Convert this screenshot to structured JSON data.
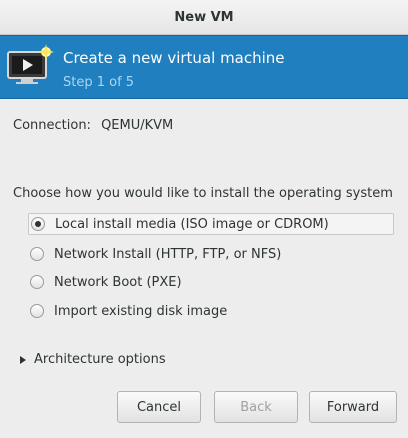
{
  "window": {
    "title": "New VM"
  },
  "banner": {
    "title": "Create a new virtual machine",
    "step": "Step 1 of 5"
  },
  "connection": {
    "label": "Connection:",
    "value": "QEMU/KVM"
  },
  "install": {
    "prompt": "Choose how you would like to install the operating system",
    "options": [
      {
        "label": "Local install media (ISO image or CDROM)",
        "selected": true
      },
      {
        "label": "Network Install (HTTP, FTP, or NFS)",
        "selected": false
      },
      {
        "label": "Network Boot (PXE)",
        "selected": false
      },
      {
        "label": "Import existing disk image",
        "selected": false
      }
    ]
  },
  "architecture": {
    "label": "Architecture options",
    "expanded": false
  },
  "buttons": {
    "cancel": "Cancel",
    "back": "Back",
    "forward": "Forward"
  },
  "colors": {
    "banner": "#1f7fbf",
    "step_text": "#a7d7f7"
  },
  "icons": {
    "banner": "vm-screen-icon"
  }
}
